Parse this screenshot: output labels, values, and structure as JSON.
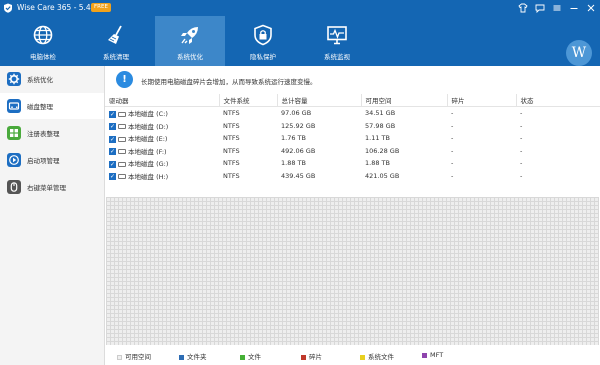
{
  "titlebar": {
    "title": "Wise Care 365 - 5.4.9",
    "badge": "FREE"
  },
  "nav": {
    "items": [
      {
        "label": "电脑体检",
        "icon": "globe-icon"
      },
      {
        "label": "系统清理",
        "icon": "broom-icon"
      },
      {
        "label": "系统优化",
        "icon": "rocket-icon",
        "active": true
      },
      {
        "label": "隐私保护",
        "icon": "lock-shield-icon"
      },
      {
        "label": "系统监视",
        "icon": "monitor-icon"
      }
    ],
    "avatar": "W"
  },
  "sidebar": {
    "items": [
      {
        "label": "系统优化",
        "icon": "gear-icon"
      },
      {
        "label": "磁盘整理",
        "icon": "disk-icon",
        "active": true
      },
      {
        "label": "注册表整理",
        "icon": "grid-icon"
      },
      {
        "label": "启动项管理",
        "icon": "play-icon"
      },
      {
        "label": "右键菜单管理",
        "icon": "mouse-icon"
      }
    ]
  },
  "notice": {
    "text": "长期使用电脑磁盘碎片会增加，从而导致系统运行速度变慢。"
  },
  "table": {
    "headers": [
      "驱动器",
      "文件系统",
      "总计容量",
      "可用空间",
      "碎片",
      "状态"
    ],
    "rows": [
      {
        "drive": "本地磁盘 (C:)",
        "fs": "NTFS",
        "total": "97.06 GB",
        "free": "34.51 GB",
        "frag": "-",
        "status": "-"
      },
      {
        "drive": "本地磁盘 (D:)",
        "fs": "NTFS",
        "total": "125.92 GB",
        "free": "57.98 GB",
        "frag": "-",
        "status": "-"
      },
      {
        "drive": "本地磁盘 (E:)",
        "fs": "NTFS",
        "total": "1.76 TB",
        "free": "1.11 TB",
        "frag": "-",
        "status": "-"
      },
      {
        "drive": "本地磁盘 (F:)",
        "fs": "NTFS",
        "total": "492.06 GB",
        "free": "106.28 GB",
        "frag": "-",
        "status": "-"
      },
      {
        "drive": "本地磁盘 (G:)",
        "fs": "NTFS",
        "total": "1.88 TB",
        "free": "1.88 TB",
        "frag": "-",
        "status": "-"
      },
      {
        "drive": "本地磁盘 (H:)",
        "fs": "NTFS",
        "total": "439.45 GB",
        "free": "421.05 GB",
        "frag": "-",
        "status": "-"
      }
    ]
  },
  "legend": [
    {
      "label": "可用空间",
      "color": "#f0f0f0"
    },
    {
      "label": "文件夹",
      "color": "#2e6db4"
    },
    {
      "label": "文件",
      "color": "#45b035"
    },
    {
      "label": "碎片",
      "color": "#c0392b"
    },
    {
      "label": "系统文件",
      "color": "#e8d020"
    },
    {
      "label": "MFT",
      "color": "#8e44ad"
    }
  ],
  "colors": {
    "brand": "#1466b3",
    "nav_active": "#3d87c9",
    "accent": "#1d6ec2",
    "info": "#2b8be0"
  }
}
